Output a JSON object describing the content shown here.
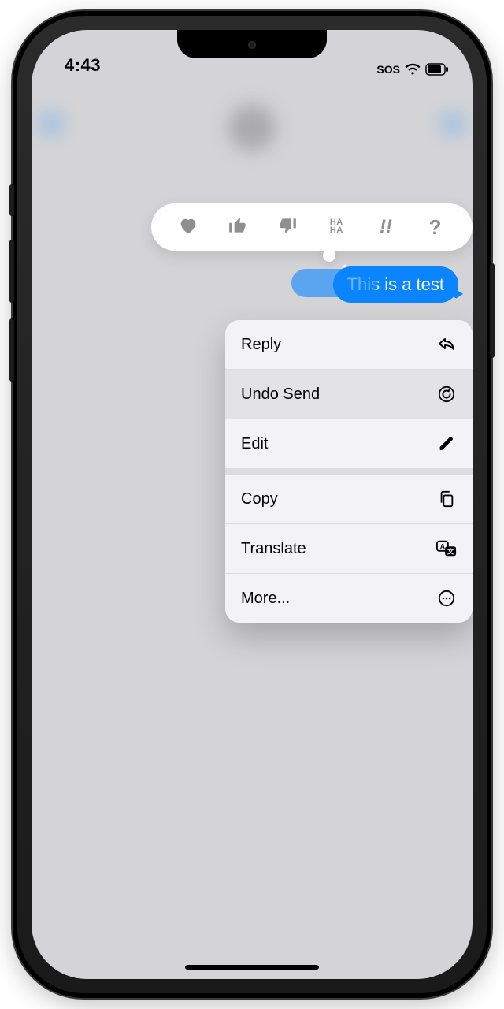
{
  "status": {
    "time": "4:43",
    "sos": "SOS"
  },
  "tapback": {
    "heart": "heart",
    "thumbs_up": "thumbs-up",
    "thumbs_down": "thumbs-down",
    "haha": "HA HA",
    "exclaim": "!!",
    "question": "?"
  },
  "message": {
    "text": "This is a test"
  },
  "menu": {
    "reply": "Reply",
    "undo_send": "Undo Send",
    "edit": "Edit",
    "copy": "Copy",
    "translate": "Translate",
    "more": "More..."
  },
  "colors": {
    "bubble": "#0a84ff",
    "menu_bg": "#f3f3f5",
    "tapback_icon": "#8e8e93"
  }
}
